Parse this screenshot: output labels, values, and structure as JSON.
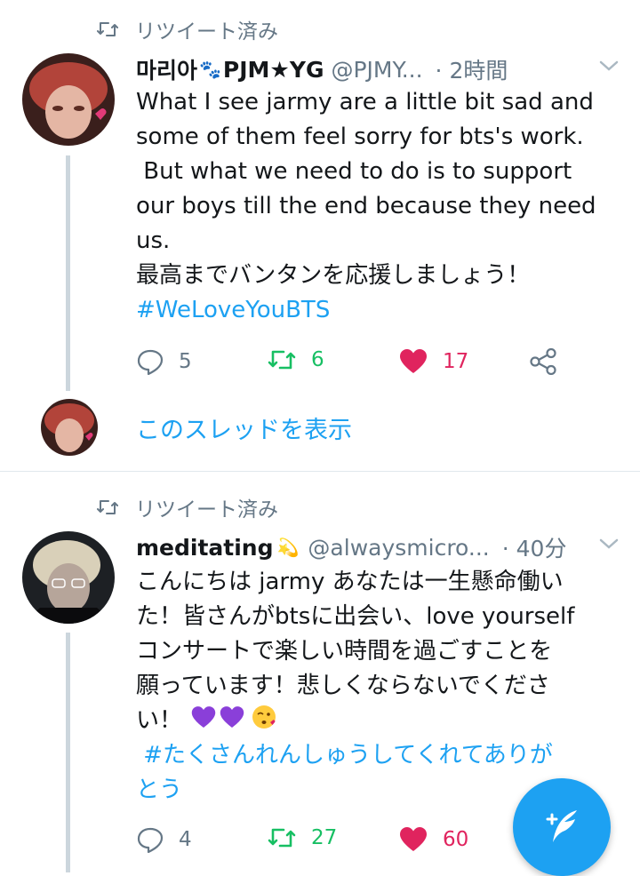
{
  "tweets": [
    {
      "retweet_label": "リツイート済み",
      "display_name": "마리아",
      "display_name_suffix": "PJM★YG",
      "handle": "@PJMY...",
      "time": "· 2時間",
      "text": "What I see jarmy are a little bit sad and\nsome of them feel sorry for bts's work.\n But what we need to do is to support\nour boys till the end because they need\nus.\n最高までバンタンを応援しましょう！",
      "hashtag": "#WeLoveYouBTS",
      "replies": "5",
      "retweets": "6",
      "likes": "17",
      "thread_link": "このスレッドを表示"
    },
    {
      "retweet_label": "リツイート済み",
      "display_name": "meditating",
      "handle": "@alwaysmicro...",
      "time": "· 40分",
      "text": "こんにちは jarmy あなたは一生懸命働い\nた！皆さんがbtsに出会い、love yourself\nコンサートで楽しい時間を過ごすことを\n願っています！悲しくならないでくださ\nい！",
      "hashtag": " #たくさんれんしゅうしてくれてありが\nとう",
      "replies": "4",
      "retweets": "27",
      "likes": "60"
    }
  ],
  "colors": {
    "accent": "#1da1f2",
    "retweet": "#17bf63",
    "like": "#e0245e",
    "muted": "#657786"
  },
  "icons": [
    "retweet-icon",
    "reply-icon",
    "heart-icon",
    "share-icon",
    "chevron-down-icon",
    "paw-icon",
    "dizzy-icon",
    "purple-heart-icon",
    "kissing-face-icon",
    "compose-tweet-icon"
  ]
}
